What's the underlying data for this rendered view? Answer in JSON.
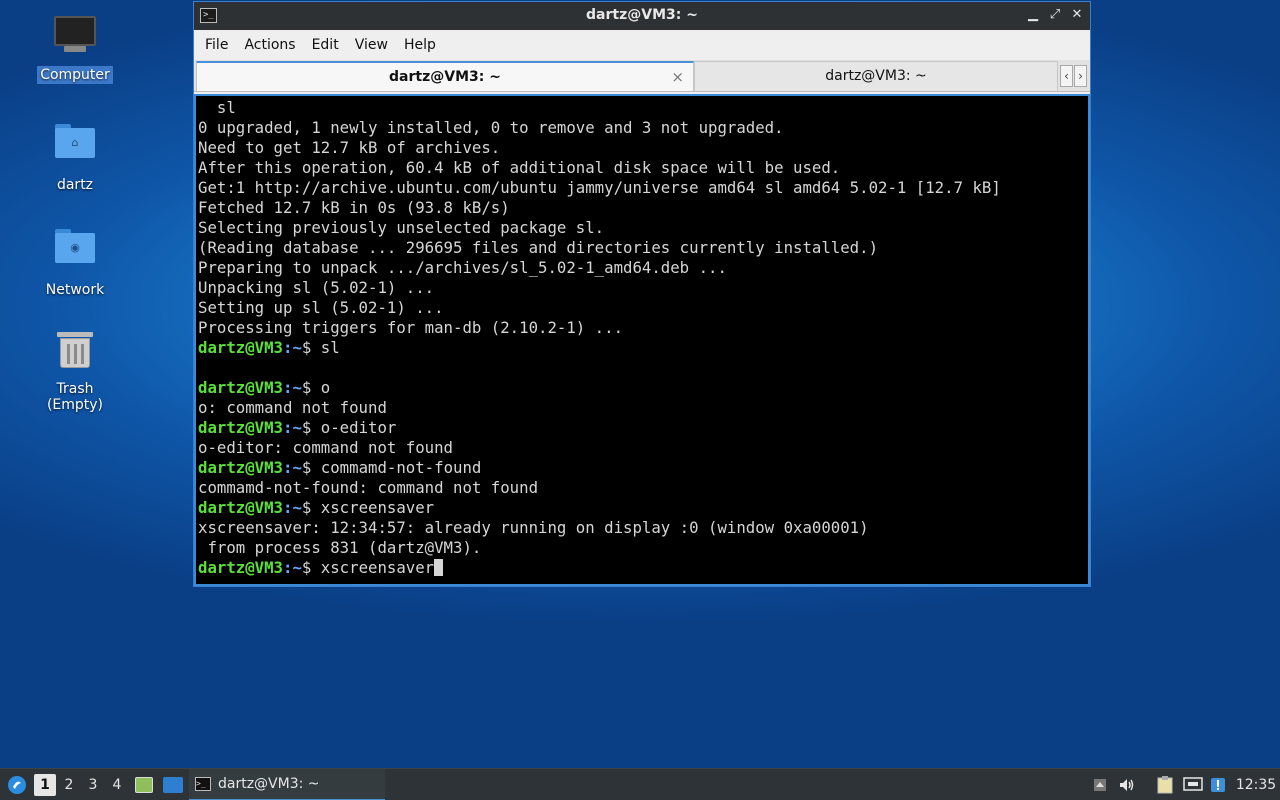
{
  "desktop": {
    "icons": [
      {
        "label": "Computer",
        "icon": "computer-icon"
      },
      {
        "label": "dartz",
        "icon": "home-folder-icon"
      },
      {
        "label": "Network",
        "icon": "network-folder-icon"
      },
      {
        "label": "Trash (Empty)",
        "icon": "trash-icon"
      }
    ]
  },
  "window": {
    "title": "dartz@VM3: ~",
    "menu": [
      "File",
      "Actions",
      "Edit",
      "View",
      "Help"
    ],
    "tabs": [
      {
        "label": "dartz@VM3: ~",
        "active": true
      },
      {
        "label": "dartz@VM3: ~",
        "active": false
      }
    ],
    "tab_close": "×",
    "tab_prev": "‹",
    "tab_next": "›"
  },
  "terminal": {
    "prompt_user": "dartz@VM3",
    "prompt_path": ":~",
    "lines": [
      {
        "text": "  sl"
      },
      {
        "text": "0 upgraded, 1 newly installed, 0 to remove and 3 not upgraded."
      },
      {
        "text": "Need to get 12.7 kB of archives."
      },
      {
        "text": "After this operation, 60.4 kB of additional disk space will be used."
      },
      {
        "text": "Get:1 http://archive.ubuntu.com/ubuntu jammy/universe amd64 sl amd64 5.02-1 [12.7 kB]"
      },
      {
        "text": "Fetched 12.7 kB in 0s (93.8 kB/s)"
      },
      {
        "text": "Selecting previously unselected package sl."
      },
      {
        "text": "(Reading database ... 296695 files and directories currently installed.)"
      },
      {
        "text": "Preparing to unpack .../archives/sl_5.02-1_amd64.deb ..."
      },
      {
        "text": "Unpacking sl (5.02-1) ..."
      },
      {
        "text": "Setting up sl (5.02-1) ..."
      },
      {
        "text": "Processing triggers for man-db (2.10.2-1) ..."
      },
      {
        "prompt": true,
        "cmd": "$ sl"
      },
      {
        "text": ""
      },
      {
        "prompt": true,
        "cmd": "$ o"
      },
      {
        "text": "o: command not found"
      },
      {
        "prompt": true,
        "cmd": "$ o-editor"
      },
      {
        "text": "o-editor: command not found"
      },
      {
        "prompt": true,
        "cmd": "$ commamd-not-found"
      },
      {
        "text": "commamd-not-found: command not found"
      },
      {
        "prompt": true,
        "cmd": "$ xscreensaver"
      },
      {
        "text": "xscreensaver: 12:34:57: already running on display :0 (window 0xa00001)"
      },
      {
        "text": " from process 831 (dartz@VM3)."
      },
      {
        "prompt": true,
        "cmd": "$ xscreensaver",
        "cursor": true
      }
    ]
  },
  "taskbar": {
    "workspaces": [
      "1",
      "2",
      "3",
      "4"
    ],
    "active_workspace": "1",
    "task_label": "dartz@VM3: ~",
    "clock": "12:35"
  },
  "colors": {
    "prompt_user": "#5be03a",
    "prompt_path": "#6aa6ff",
    "accent": "#4a90d9"
  }
}
